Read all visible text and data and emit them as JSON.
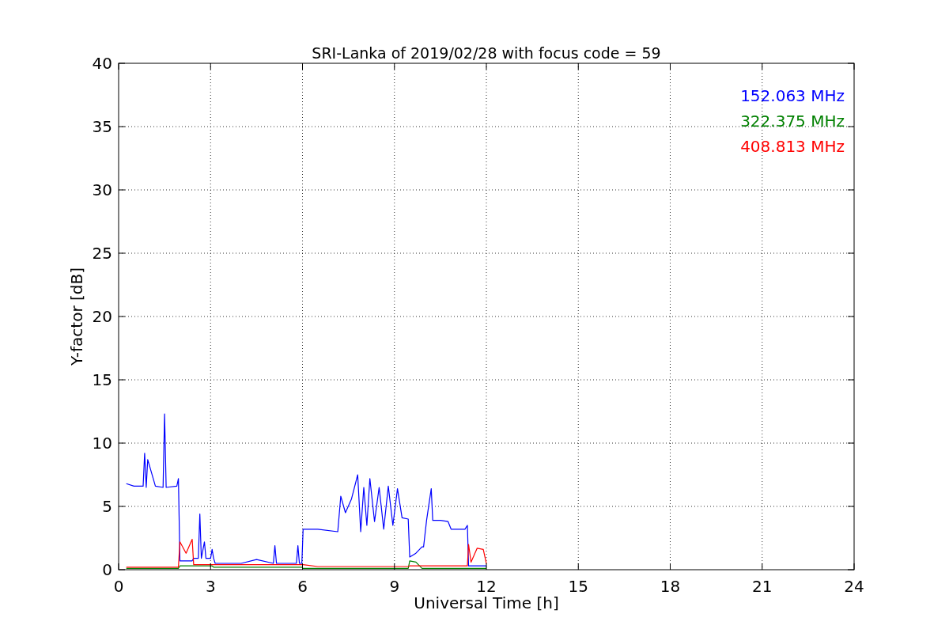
{
  "chart_data": {
    "type": "line",
    "title": "SRI-Lanka of 2019/02/28 with focus code = 59",
    "xlabel": "Universal Time [h]",
    "ylabel": "Y-factor [dB]",
    "grid": true,
    "xlim": [
      0,
      24
    ],
    "ylim": [
      0,
      40
    ],
    "xticks": [
      0,
      3,
      6,
      9,
      12,
      15,
      18,
      21,
      24
    ],
    "yticks": [
      0,
      5,
      10,
      15,
      20,
      25,
      30,
      35,
      40
    ],
    "x": [
      0.25,
      0.5,
      0.8,
      0.85,
      0.9,
      0.95,
      1.2,
      1.45,
      1.5,
      1.55,
      1.9,
      1.95,
      2.0,
      2.2,
      2.4,
      2.45,
      2.6,
      2.65,
      2.7,
      2.8,
      2.85,
      3.0,
      3.05,
      3.1,
      3.15,
      4.0,
      4.5,
      5.05,
      5.1,
      5.15,
      5.8,
      5.85,
      5.9,
      5.98,
      6.02,
      6.5,
      7.15,
      7.25,
      7.4,
      7.6,
      7.8,
      7.9,
      8.0,
      8.1,
      8.2,
      8.35,
      8.5,
      8.65,
      8.8,
      8.95,
      9.1,
      9.25,
      9.45,
      9.5,
      9.7,
      9.9,
      9.95,
      10.05,
      10.2,
      10.25,
      10.5,
      10.75,
      10.85,
      11.3,
      11.38,
      11.42,
      11.5,
      11.7,
      11.9,
      12.0
    ],
    "series": [
      {
        "name": "152.063 MHz",
        "color": "#0000ff",
        "values": [
          6.8,
          6.6,
          6.6,
          9.2,
          6.5,
          8.7,
          6.6,
          6.5,
          12.3,
          6.5,
          6.6,
          7.2,
          0.7,
          0.7,
          0.7,
          0.9,
          0.9,
          4.4,
          0.9,
          2.2,
          0.9,
          0.9,
          1.6,
          0.9,
          0.5,
          0.5,
          0.8,
          0.5,
          1.9,
          0.5,
          0.5,
          1.9,
          0.5,
          0.5,
          3.2,
          3.2,
          3.0,
          5.8,
          4.5,
          5.6,
          7.5,
          3.0,
          6.5,
          3.5,
          7.2,
          3.8,
          6.5,
          3.2,
          6.6,
          3.5,
          6.4,
          4.1,
          4.0,
          1.0,
          1.3,
          1.8,
          1.8,
          3.9,
          6.4,
          3.9,
          3.9,
          3.8,
          3.2,
          3.2,
          3.5,
          0.3,
          0.3,
          0.3,
          0.3,
          0.3
        ]
      },
      {
        "name": "322.375 MHz",
        "color": "#008000",
        "values": [
          0.1,
          0.1,
          0.1,
          0.1,
          0.1,
          0.1,
          0.1,
          0.1,
          0.1,
          0.1,
          0.1,
          0.1,
          0.3,
          0.3,
          0.3,
          0.3,
          0.3,
          0.3,
          0.3,
          0.3,
          0.3,
          0.3,
          0.3,
          0.2,
          0.2,
          0.2,
          0.2,
          0.2,
          0.2,
          0.2,
          0.2,
          0.2,
          0.2,
          0.2,
          0.1,
          0.1,
          0.1,
          0.1,
          0.1,
          0.1,
          0.1,
          0.1,
          0.1,
          0.1,
          0.1,
          0.1,
          0.1,
          0.1,
          0.1,
          0.1,
          0.1,
          0.1,
          0.1,
          0.7,
          0.6,
          0.1,
          0.1,
          0.1,
          0.1,
          0.1,
          0.1,
          0.1,
          0.1,
          0.1,
          0.1,
          0.1,
          0.1,
          0.1,
          0.1,
          0.1
        ]
      },
      {
        "name": "408.813 MHz",
        "color": "#ff0000",
        "values": [
          0.2,
          0.2,
          0.2,
          0.2,
          0.2,
          0.2,
          0.2,
          0.2,
          0.2,
          0.2,
          0.2,
          0.2,
          2.2,
          1.3,
          2.4,
          0.4,
          0.4,
          0.4,
          0.4,
          0.4,
          0.4,
          0.4,
          0.4,
          0.4,
          0.4,
          0.4,
          0.4,
          0.4,
          0.4,
          0.4,
          0.4,
          0.4,
          0.4,
          0.4,
          0.4,
          0.25,
          0.25,
          0.25,
          0.25,
          0.25,
          0.25,
          0.25,
          0.25,
          0.25,
          0.25,
          0.25,
          0.25,
          0.25,
          0.25,
          0.25,
          0.25,
          0.25,
          0.25,
          0.3,
          0.3,
          0.3,
          0.3,
          0.3,
          0.3,
          0.3,
          0.3,
          0.3,
          0.3,
          0.3,
          0.3,
          2.0,
          0.6,
          1.7,
          1.6,
          0.5
        ]
      }
    ]
  }
}
